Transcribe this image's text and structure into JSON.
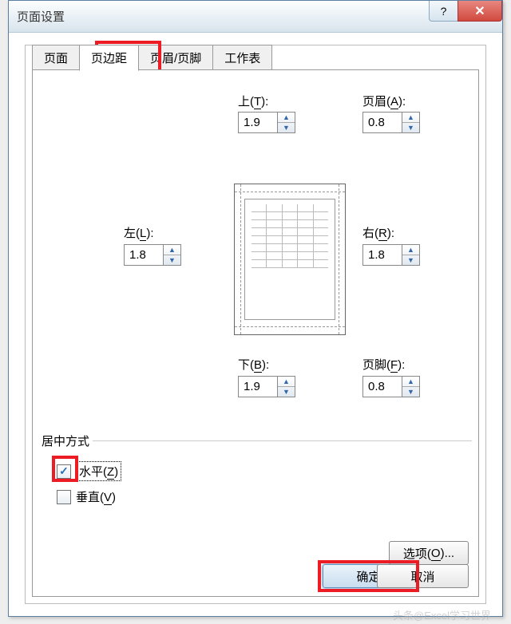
{
  "window": {
    "title": "页面设置"
  },
  "tabs": {
    "page": "页面",
    "margins": "页边距",
    "headerfooter": "页眉/页脚",
    "sheet": "工作表"
  },
  "labels": {
    "top": "上(T):",
    "header": "页眉(A):",
    "left": "左(L):",
    "right": "右(R):",
    "bottom": "下(B):",
    "footer": "页脚(F):",
    "centering": "居中方式",
    "horizontal": "水平(Z)",
    "vertical": "垂直(V)"
  },
  "values": {
    "top": "1.9",
    "header": "0.8",
    "left": "1.8",
    "right": "1.8",
    "bottom": "1.9",
    "footer": "0.8"
  },
  "checkboxes": {
    "horizontal": true,
    "vertical": false
  },
  "buttons": {
    "options": "选项(O)...",
    "ok": "确定",
    "cancel": "取消"
  },
  "watermark": "头条@Excel学习世界"
}
